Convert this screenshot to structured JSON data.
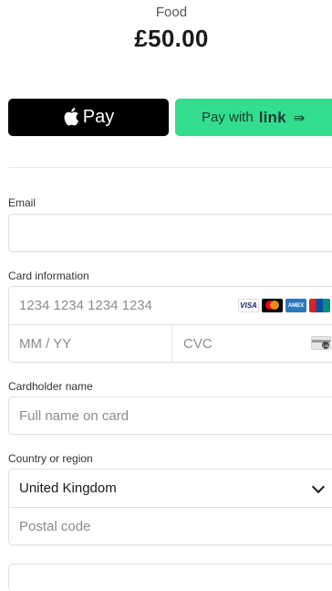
{
  "order": {
    "product": "Food",
    "amount": "£50.00"
  },
  "wallets": {
    "apple_pay_label": "Pay",
    "link_prefix": "Pay with",
    "link_word": "link",
    "link_arrow": "⇛"
  },
  "email": {
    "label": "Email",
    "value": ""
  },
  "card": {
    "label": "Card information",
    "number_placeholder": "1234 1234 1234 1234",
    "expiry_placeholder": "MM / YY",
    "cvc_placeholder": "CVC",
    "brands": [
      "VISA",
      "Mastercard",
      "AMEX",
      "UnionPay"
    ]
  },
  "cardholder": {
    "label": "Cardholder name",
    "placeholder": "Full name on card"
  },
  "country": {
    "label": "Country or region",
    "selected": "United Kingdom",
    "postal_placeholder": "Postal code"
  }
}
